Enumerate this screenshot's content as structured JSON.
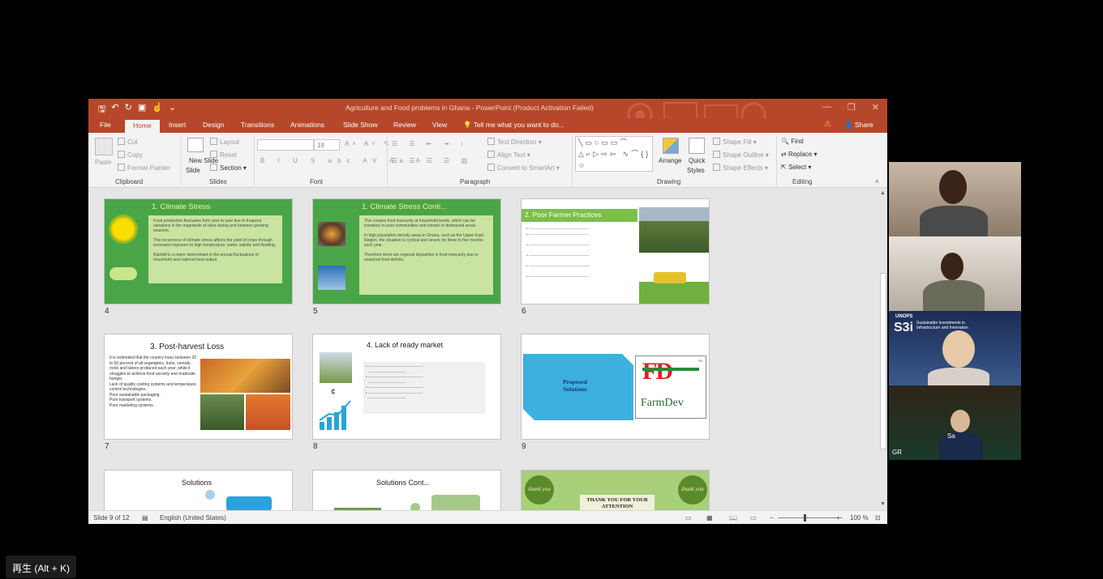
{
  "window": {
    "title": "Agriculture and Food problems in Ghana - PowerPoint (Product Activation Failed)",
    "tabs": [
      "File",
      "Home",
      "Insert",
      "Design",
      "Transitions",
      "Animations",
      "Slide Show",
      "Review",
      "View"
    ],
    "active_tab": "Home",
    "tell_me": "Tell me what you want to do...",
    "share": "Share"
  },
  "ribbon": {
    "clipboard": {
      "label": "Clipboard",
      "paste": "Paste",
      "cut": "Cut",
      "copy": "Copy",
      "format_painter": "Format Painter"
    },
    "slides": {
      "label": "Slides",
      "new_slide": "New Slide",
      "new_slide_sub": "Slide",
      "layout": "Layout",
      "reset": "Reset",
      "section": "Section"
    },
    "font": {
      "label": "Font",
      "size": "18"
    },
    "paragraph": {
      "label": "Paragraph",
      "text_direction": "Text Direction",
      "align_text": "Align Text",
      "convert_smartart": "Convert to SmartArt"
    },
    "drawing": {
      "label": "Drawing",
      "arrange": "Arrange",
      "quick_styles": "Quick Styles",
      "quick": "Quick",
      "styles": "Styles",
      "shape_fill": "Shape Fill",
      "shape_outline": "Shape Outline",
      "shape_effects": "Shape Effects"
    },
    "editing": {
      "label": "Editing",
      "find": "Find",
      "replace": "Replace",
      "select": "Select"
    }
  },
  "slides": {
    "s4": {
      "num": "4",
      "title": "1. Climate Stress",
      "p1": "Food production fluctuates from year to year due to frequent variations in the magnitude of rains during and between growing seasons.",
      "p2": "This recurrence of climatic stress affects the yield of crops through increased exposure to high temperature, water, salinity and flooding.",
      "p3": "Rainfall is a major determinant in the annual fluctuations of household and national food output."
    },
    "s5": {
      "num": "5",
      "title": "1. Climate Stress Conti...",
      "p1": "This creates food insecurity at household levels, which can be transitory in poor communities and chronic in distressed areas.",
      "p2": "In high population density areas in Ghana, such as the Upper East Region, the situation is cyclical and severe for three to five months each year.",
      "p3": "Therefore there are regional disparities in food insecurity due to seasonal food deficits."
    },
    "s6": {
      "num": "6",
      "title": "2. Poor Farmer Practices"
    },
    "s7": {
      "num": "7",
      "title": "3. Post-harvest Loss",
      "bullets": [
        "It is estimated that the country loses between 20 to 50 percent of all vegetables, fruits, cereals, roots and tubers produced each year, while it struggles to achieve food security and eradicate hunger.",
        "Lack of quality cooling systems and temperature control technologies.",
        "Poor sustainable packaging.",
        "Poor transport systems.",
        "Poor marketing systems."
      ]
    },
    "s8": {
      "num": "8",
      "title": "4. Lack of ready market",
      "currency": "¢"
    },
    "s9": {
      "num": "9",
      "proposed": "Proposed Solutions",
      "logo_text": "FarmDev",
      "logo_letters": "FD",
      "tm": "TM"
    },
    "s10": {
      "title": "Solutions"
    },
    "s11": {
      "title": "Solutions Cont..."
    },
    "s12": {
      "thanks": "THANK YOU FOR YOUR ATTENTION",
      "badge": "thank you"
    }
  },
  "status": {
    "slide": "Slide 9 of 12",
    "language": "English (United States)",
    "zoom": "100 %"
  },
  "videos": {
    "v3_org": "UNOPS",
    "v3_sub": "Sustainable Investments in Infrastructure and Innovation",
    "v3_logo": "S3i",
    "v4_name": "Sa",
    "v4_left": "GR"
  },
  "playhint": "再生 (Alt + K)",
  "colors": {
    "ppt_red": "#b7472a",
    "slide_green": "#4aa547",
    "panel_green": "#c8e4a0"
  }
}
